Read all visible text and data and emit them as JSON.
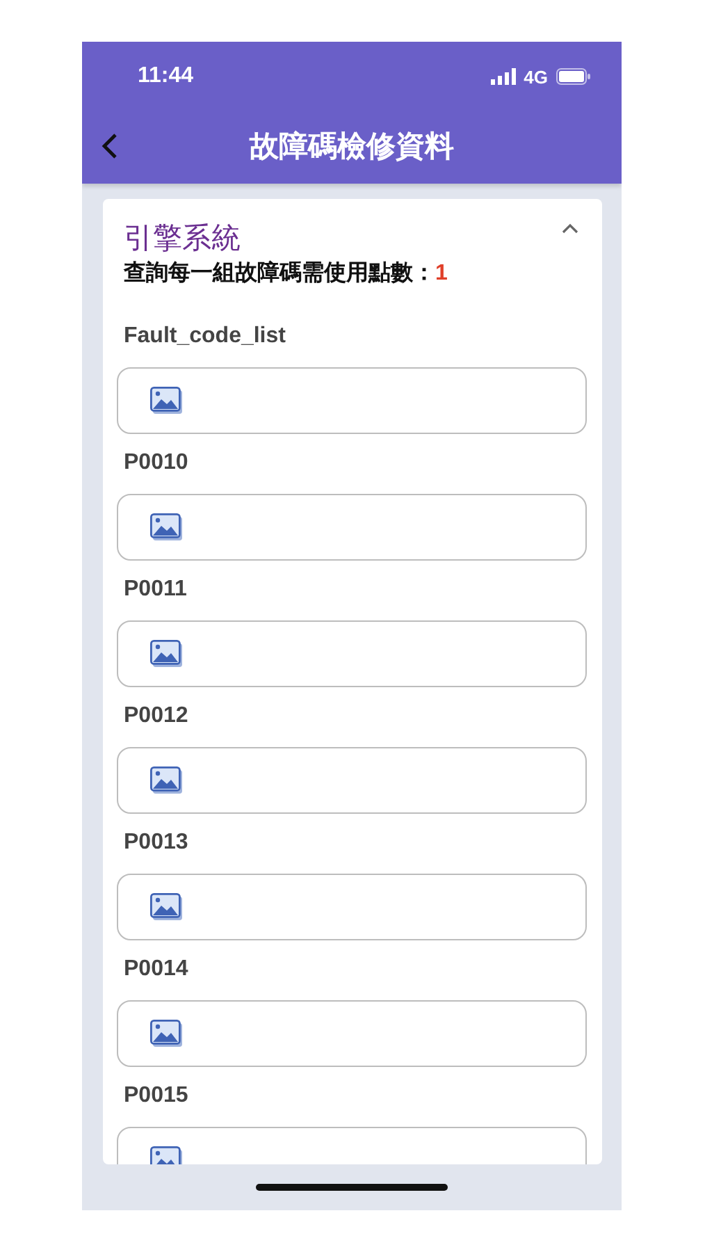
{
  "status_bar": {
    "time": "11:44",
    "network": "4G"
  },
  "header": {
    "title": "故障碼檢修資料"
  },
  "section": {
    "title": "引擎系統",
    "expanded": true,
    "points_label": "查詢每一組故障碼需使用點數：",
    "points_value": "1"
  },
  "fields": [
    {
      "label": "Fault_code_list",
      "kind": "image"
    },
    {
      "label": "P0010",
      "kind": "image"
    },
    {
      "label": "P0011",
      "kind": "image"
    },
    {
      "label": "P0012",
      "kind": "image"
    },
    {
      "label": "P0013",
      "kind": "image"
    },
    {
      "label": "P0014",
      "kind": "image"
    },
    {
      "label": "P0015",
      "kind": "image"
    }
  ]
}
